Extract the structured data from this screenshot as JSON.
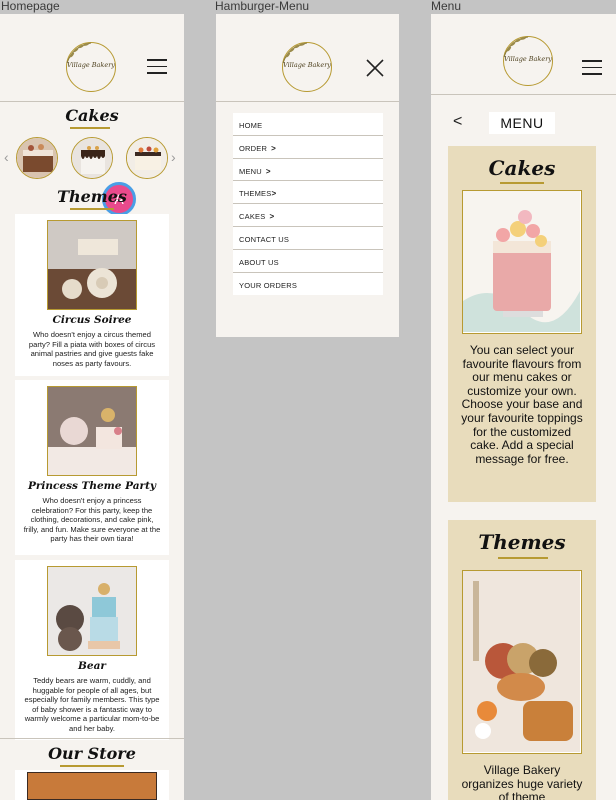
{
  "frames": {
    "homepage_label": "Homepage",
    "hamburger_label": "Hamburger-Menu",
    "menu_label": "Menu"
  },
  "logo": {
    "text": "Village Bakery"
  },
  "homepage": {
    "cakes_heading": "Cakes",
    "themes_heading": "Themes",
    "badge": "A",
    "cards": [
      {
        "title": "Circus Soiree",
        "desc": "Who doesn't enjoy a circus themed party? Fill a piata with boxes of circus animal pastries and give guests fake noses as party favours."
      },
      {
        "title": "Princess Theme Party",
        "desc": "Who doesn't enjoy a princess celebration? For this party, keep the clothing, decorations, and cake pink, frilly, and fun. Make sure everyone at the party has their own tiara!"
      },
      {
        "title": "Bear",
        "desc": "Teddy bears are warm, cuddly, and huggable for people of all ages, but especially for family members. This type of baby shower is a fantastic way to warmly welcome a particular mom-to-be and her baby."
      }
    ],
    "store_heading": "Our Store"
  },
  "hamburger": {
    "items": [
      {
        "label": "HOME",
        "chevron": ""
      },
      {
        "label": "ORDER",
        "chevron": ">"
      },
      {
        "label": "MENU",
        "chevron": ">"
      },
      {
        "label": "THEMES",
        "chevron": ">"
      },
      {
        "label": "CAKES",
        "chevron": ">"
      },
      {
        "label": "CONTACT US",
        "chevron": ""
      },
      {
        "label": "ABOUT US",
        "chevron": ""
      },
      {
        "label": "YOUR ORDERS",
        "chevron": ""
      }
    ]
  },
  "menu_page": {
    "back": "<",
    "title": "MENU",
    "cakes_heading": "Cakes",
    "cakes_text": "You can select your favourite flavours from our menu cakes or customize your own. Choose your base and your favourite toppings for the customized cake. Add a special message for free.",
    "themes_heading": "Themes",
    "themes_text": "Village Bakery organizes huge variety of theme"
  },
  "colors": {
    "gold": "#b79a32",
    "badge": "#e94a8c",
    "panel": "#e8dcbc",
    "background": "#f6f3ef"
  }
}
